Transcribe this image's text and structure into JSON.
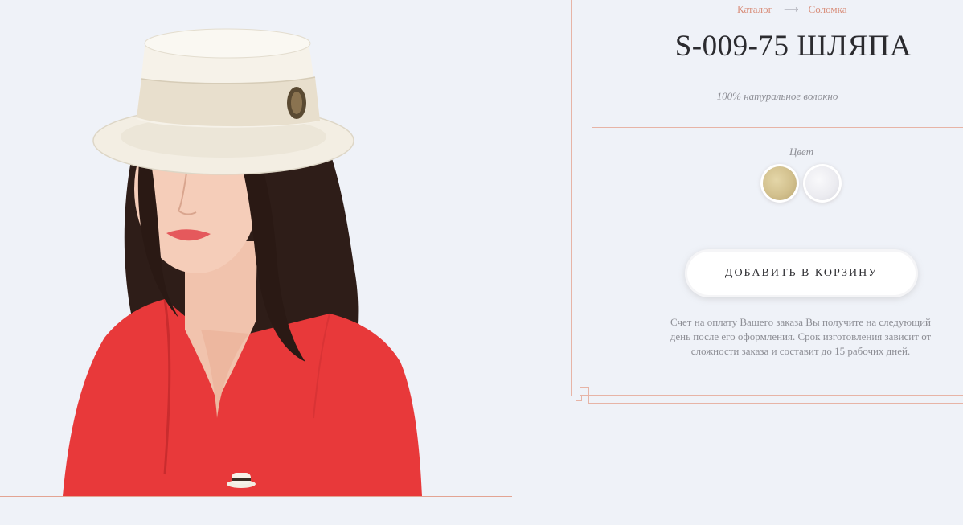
{
  "breadcrumb": {
    "items": [
      "Каталог",
      "Соломка"
    ],
    "separator": "⟶"
  },
  "product": {
    "title": "S-009-75 ШЛЯПА",
    "material": "100% натуральное волокно",
    "color_label": "Цвет",
    "colors": [
      {
        "name": "straw-swatch",
        "hex": "#d2c08d"
      },
      {
        "name": "white-swatch",
        "hex": "#ebebf0"
      }
    ],
    "add_to_cart": "ДОБАВИТЬ В КОРЗИНУ",
    "note": "Счет на оплату Вашего заказа Вы получите на следующий день после его оформления. Срок изготовления зависит от сложности заказа и составит до 15 рабочих дней."
  },
  "colors": {
    "background": "#eff2f8",
    "accent": "#d9907d",
    "frame": "#e7b4a6",
    "shirt": "#e93a3a",
    "hat": "#f2ede2"
  }
}
